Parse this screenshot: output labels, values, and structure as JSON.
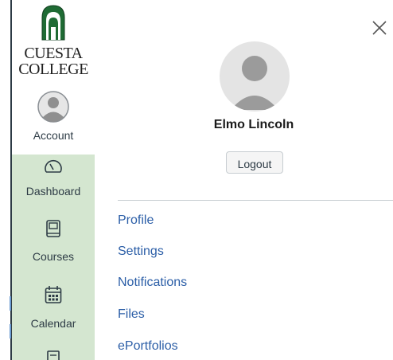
{
  "brand": {
    "name_line1": "CUESTA",
    "name_line2": "COLLEGE",
    "colors": {
      "green": "#1f6b34",
      "sidebar_active": "#d4e6d0",
      "link": "#2b5ea7"
    }
  },
  "nav": {
    "account": {
      "label": "Account",
      "icon": "user-avatar-icon"
    },
    "dashboard": {
      "label": "Dashboard",
      "icon": "speedometer-icon"
    },
    "courses": {
      "label": "Courses",
      "icon": "book-icon"
    },
    "calendar": {
      "label": "Calendar",
      "icon": "calendar-icon"
    },
    "inbox": {
      "label": "",
      "icon": "inbox-icon"
    }
  },
  "tray": {
    "close_icon": "close-icon",
    "user_name": "Elmo Lincoln",
    "logout_label": "Logout",
    "links": [
      "Profile",
      "Settings",
      "Notifications",
      "Files",
      "ePortfolios"
    ]
  }
}
